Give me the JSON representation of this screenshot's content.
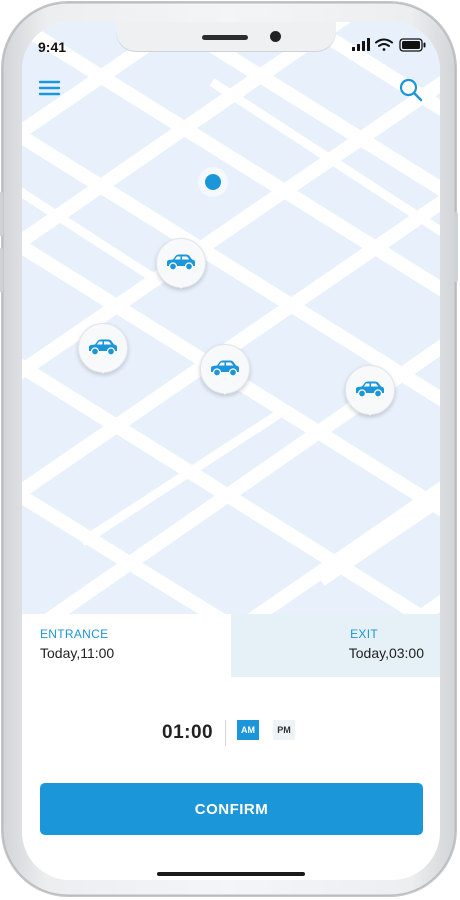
{
  "status_bar": {
    "time": "9:41"
  },
  "map": {
    "icons": {
      "menu": "menu-icon",
      "search": "search-icon",
      "location": "current-location-icon",
      "car": "car-icon"
    },
    "parking_pins": [
      "parking-spot-1",
      "parking-spot-2",
      "parking-spot-3",
      "parking-spot-4"
    ]
  },
  "entrance": {
    "label": "ENTRANCE",
    "value": "Today,11:00"
  },
  "exit": {
    "label": "EXIT",
    "value": "Today,03:00"
  },
  "time_picker": {
    "time": "01:00",
    "am_label": "AM",
    "pm_label": "PM",
    "selected": "AM"
  },
  "confirm_label": "CONFIRM",
  "colors": {
    "accent": "#1b96d9",
    "map_background": "#e8f0fc",
    "exit_background": "#e6f1f7"
  }
}
